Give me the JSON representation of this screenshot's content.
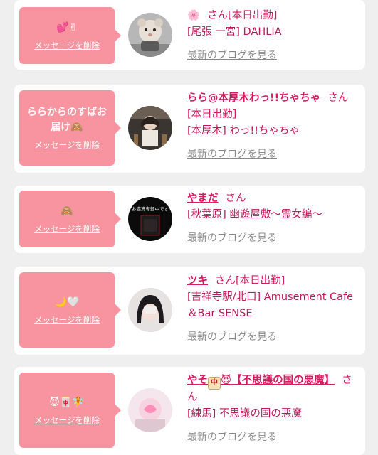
{
  "cards": [
    {
      "bubble_emoji": "💕✌",
      "bubble_text": "",
      "delete_label": "メッセージを削除",
      "name": "🌸",
      "san": "さん",
      "status": "[本日出勤]",
      "shop": "[尾張 一宮] DAHLIA",
      "blog_label": "最新のブログを見る"
    },
    {
      "bubble_emoji": "",
      "bubble_text": "ららからのすばお届け🙈",
      "delete_label": "メッセージを削除",
      "name": "らら@本厚木わっ!!ちゃちゃ",
      "san": "さん",
      "status": "[本日出勤]",
      "shop": "[本厚木] わっ!!ちゃちゃ",
      "blog_label": "最新のブログを見る"
    },
    {
      "bubble_emoji": "🙈",
      "bubble_text": "",
      "delete_label": "メッセージを削除",
      "name": "やまだ",
      "san": "さん",
      "status": "",
      "shop": "[秋葉原] 幽遊屋敷〜霊女編〜",
      "blog_label": "最新のブログを見る",
      "avatar_text": "お遊賞専部中です"
    },
    {
      "bubble_emoji": "🌙🤍",
      "bubble_text": "",
      "delete_label": "メッセージを削除",
      "name": "ツキ",
      "san": "さん",
      "status": "[本日出勤]",
      "shop": "[吉祥寺駅/北口] Amusement Cafe ＆Bar SENSE",
      "blog_label": "最新のブログを見る"
    },
    {
      "bubble_emoji": "😈🀄🧚",
      "bubble_text": "",
      "delete_label": "メッセージを削除",
      "name_prefix": "やそ",
      "name_tile": "中",
      "name_emoji": "😈",
      "name": "【不思議の国の悪魔】",
      "san": "さん",
      "status": "",
      "shop": "[練馬] 不思議の国の悪魔",
      "blog_label": "最新のブログを見る"
    }
  ],
  "colors": {
    "accent": "#f7949f",
    "name": "#d81b60",
    "shop": "#c2185b",
    "muted": "#888888",
    "background": "#efefef"
  }
}
